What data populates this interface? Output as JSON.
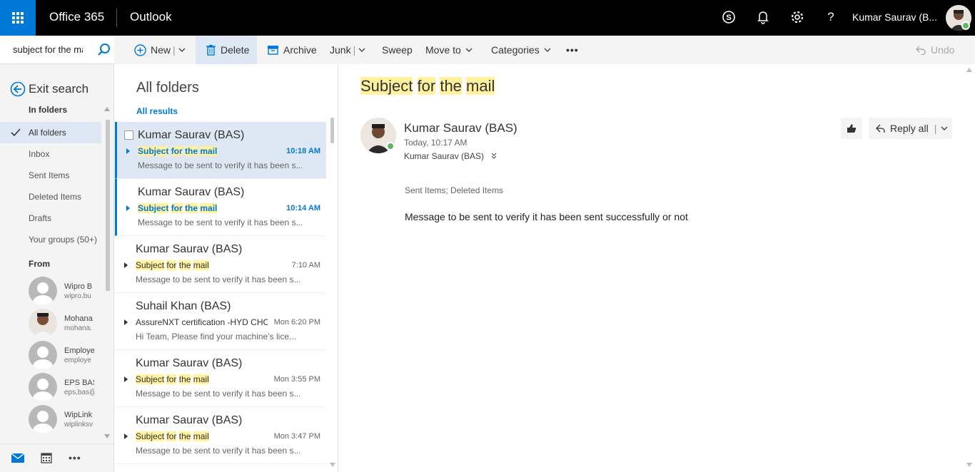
{
  "topbar": {
    "brand": "Office 365",
    "app": "Outlook",
    "user_name": "Kumar Saurav (B...",
    "icons": [
      "waffle-icon",
      "skype-icon",
      "bell-icon",
      "gear-icon",
      "help-icon"
    ],
    "help_glyph": "?"
  },
  "search": {
    "value": "subject for the mail"
  },
  "commands": {
    "new": "New",
    "delete": "Delete",
    "archive": "Archive",
    "junk": "Junk",
    "sweep": "Sweep",
    "move_to": "Move to",
    "categories": "Categories",
    "more": "•••",
    "undo": "Undo"
  },
  "leftnav": {
    "exit_search": "Exit search",
    "in_folders": "In folders",
    "folders": [
      {
        "label": "All folders"
      },
      {
        "label": "Inbox"
      },
      {
        "label": "Sent Items"
      },
      {
        "label": "Deleted Items"
      },
      {
        "label": "Drafts"
      },
      {
        "label": "Your groups (50+)"
      }
    ],
    "from_heading": "From",
    "from": [
      {
        "name": "Wipro B",
        "email": "wipro.bu"
      },
      {
        "name": "Mohana",
        "email": "mohana."
      },
      {
        "name": "Employe",
        "email": "employe"
      },
      {
        "name": "EPS BAS",
        "email": "eps.bas@"
      },
      {
        "name": "WipLink",
        "email": "wiplinksv"
      }
    ]
  },
  "list": {
    "title": "All folders",
    "all_results": "All results",
    "messages": [
      {
        "sender": "Kumar Saurav (BAS)",
        "subject_parts": [
          "Subject",
          "for",
          "the",
          "mail"
        ],
        "time": "10:18 AM",
        "preview": "Message to be sent to verify it has been s..."
      },
      {
        "sender": "Kumar Saurav (BAS)",
        "subject_parts": [
          "Subject",
          "for",
          "the",
          "mail"
        ],
        "time": "10:14 AM",
        "preview": "Message to be sent to verify it has been s..."
      },
      {
        "sender": "Kumar Saurav (BAS)",
        "subject_parts": [
          "Subject",
          "for",
          "the",
          "mail"
        ],
        "time": "7:10 AM",
        "preview": "Message to be sent to verify it has been s..."
      },
      {
        "sender": "Suhail Khan (BAS)",
        "subject": "AssureNXT certification -HYD CHC",
        "time": "Mon 6:20 PM",
        "preview": "Hi Team,  Please find your machine’s lice..."
      },
      {
        "sender": "Kumar Saurav (BAS)",
        "subject_parts": [
          "Subject",
          "for",
          "the",
          "mail"
        ],
        "time": "Mon 3:55 PM",
        "preview": "Message to be sent to verify it has been s..."
      },
      {
        "sender": "Kumar Saurav (BAS)",
        "subject_parts": [
          "Subject",
          "for",
          "the",
          "mail"
        ],
        "time": "Mon 3:47 PM",
        "preview": "Message to be sent to verify it has been s..."
      }
    ]
  },
  "reading": {
    "subject_parts": [
      "Subject",
      "for",
      "the",
      "mail"
    ],
    "from": "Kumar Saurav (BAS)",
    "date": "Today, 10:17 AM",
    "to": "Kumar Saurav (BAS)",
    "folders": "Sent Items; Deleted Items",
    "body": "Message to be sent to verify it has been sent successfully or not",
    "reply_all": "Reply all"
  },
  "colors": {
    "accent": "#0078d7",
    "highlight": "#fff19d",
    "topbar": "#000000",
    "selected_bg": "#dde8f4"
  }
}
